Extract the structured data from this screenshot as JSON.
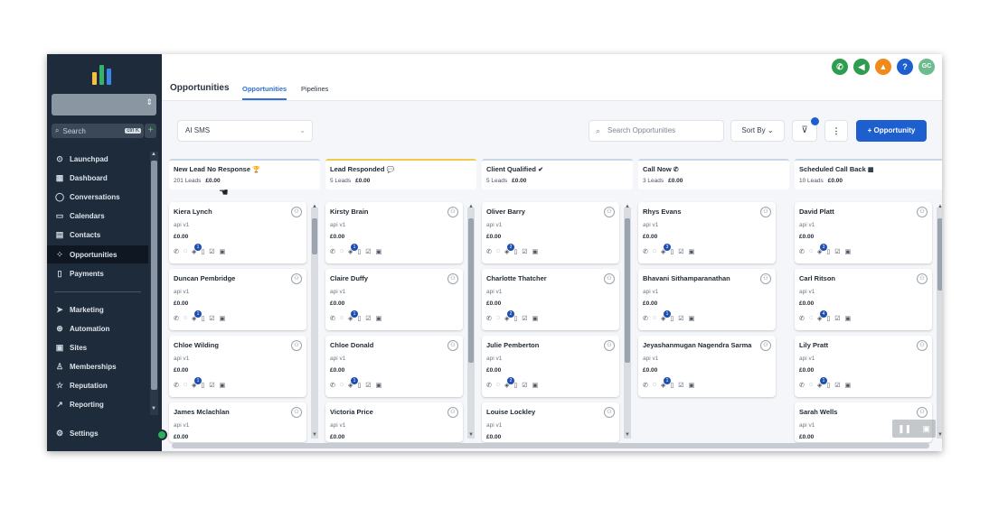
{
  "sidebar": {
    "search_placeholder": "Search",
    "search_shortcut": "ctrl K",
    "items": [
      {
        "label": "Launchpad",
        "icon": "rocket-icon"
      },
      {
        "label": "Dashboard",
        "icon": "dashboard-icon"
      },
      {
        "label": "Conversations",
        "icon": "chat-icon"
      },
      {
        "label": "Calendars",
        "icon": "calendar-icon"
      },
      {
        "label": "Contacts",
        "icon": "contacts-icon"
      },
      {
        "label": "Opportunities",
        "icon": "opportunities-icon"
      },
      {
        "label": "Payments",
        "icon": "payments-icon"
      },
      {
        "label": "Marketing",
        "icon": "send-icon"
      },
      {
        "label": "Automation",
        "icon": "automation-icon"
      },
      {
        "label": "Sites",
        "icon": "sites-icon"
      },
      {
        "label": "Memberships",
        "icon": "memberships-icon"
      },
      {
        "label": "Reputation",
        "icon": "star-icon"
      },
      {
        "label": "Reporting",
        "icon": "trend-icon"
      },
      {
        "label": "Settings",
        "icon": "gear-icon"
      }
    ],
    "active": "Opportunities"
  },
  "header": {
    "title": "Opportunities",
    "tabs": [
      "Opportunities",
      "Pipelines"
    ],
    "avatar_initials": "GC"
  },
  "toolbar": {
    "pipeline": "AI SMS",
    "search_placeholder": "Search Opportunities",
    "sort_label": "Sort By",
    "add_label": "+ Opportunity"
  },
  "stages": [
    {
      "name": "New Lead No Response",
      "count": "201 Leads",
      "value": "£0.00",
      "color": "#c9d6e6"
    },
    {
      "name": "Lead Responded",
      "count": "5 Leads",
      "value": "£0.00",
      "color": "#f2c94c"
    },
    {
      "name": "Client Qualified",
      "count": "5 Leads",
      "value": "£0.00",
      "color": "#c9d6e6"
    },
    {
      "name": "Call Now",
      "count": "3 Leads",
      "value": "£0.00",
      "color": "#c9d6e6"
    },
    {
      "name": "Scheduled Call Back",
      "count": "10 Leads",
      "value": "£0.00",
      "color": "#c9d6e6"
    }
  ],
  "cards": [
    [
      {
        "name": "Kiera Lynch",
        "source": "api v1",
        "value": "£0.00",
        "badge": "1"
      },
      {
        "name": "Duncan Pembridge",
        "source": "api v1",
        "value": "£0.00",
        "badge": "1"
      },
      {
        "name": "Chloe Wilding",
        "source": "api v1",
        "value": "£0.00",
        "badge": "1"
      },
      {
        "name": "James Mclachlan",
        "source": "api v1",
        "value": "£0.00",
        "badge": ""
      }
    ],
    [
      {
        "name": "Kirsty Brain",
        "source": "api v1",
        "value": "£0.00",
        "badge": "1"
      },
      {
        "name": "Claire Duffy",
        "source": "api v1",
        "value": "£0.00",
        "badge": "1"
      },
      {
        "name": "Chloe Donald",
        "source": "api v1",
        "value": "£0.00",
        "badge": "1"
      },
      {
        "name": "Victoria Price",
        "source": "api v1",
        "value": "£0.00",
        "badge": ""
      }
    ],
    [
      {
        "name": "Oliver Barry",
        "source": "api v1",
        "value": "£0.00",
        "badge": "2"
      },
      {
        "name": "Charlotte Thatcher",
        "source": "api v1",
        "value": "£0.00",
        "badge": "2"
      },
      {
        "name": "Julie Pemberton",
        "source": "api v1",
        "value": "£0.00",
        "badge": "2"
      },
      {
        "name": "Louise Lockley",
        "source": "api v1",
        "value": "£0.00",
        "badge": ""
      }
    ],
    [
      {
        "name": "Rhys Evans",
        "source": "api v1",
        "value": "£0.00",
        "badge": "3"
      },
      {
        "name": "Bhavani Sithamparanathan",
        "source": "api v1",
        "value": "£0.00",
        "badge": "1"
      },
      {
        "name": "Jeyashanmugan Nagendra Sarma",
        "source": "api v1",
        "value": "£0.00",
        "badge": "1"
      }
    ],
    [
      {
        "name": "David Platt",
        "source": "api v1",
        "value": "£0.00",
        "badge": "3"
      },
      {
        "name": "Carl Ritson",
        "source": "api v1",
        "value": "£0.00",
        "badge": "4"
      },
      {
        "name": "Lily Pratt",
        "source": "api v1",
        "value": "£0.00",
        "badge": "1"
      },
      {
        "name": "Sarah Wells",
        "source": "api v1",
        "value": "£0.00",
        "badge": ""
      }
    ]
  ],
  "colors": {
    "sidebar": "#1e2b3a",
    "accent": "#1e5fd0",
    "call": "#2e9d4f",
    "notify": "#f08a1c",
    "help": "#1e5fd0",
    "avatar": "#6dbb8f"
  }
}
